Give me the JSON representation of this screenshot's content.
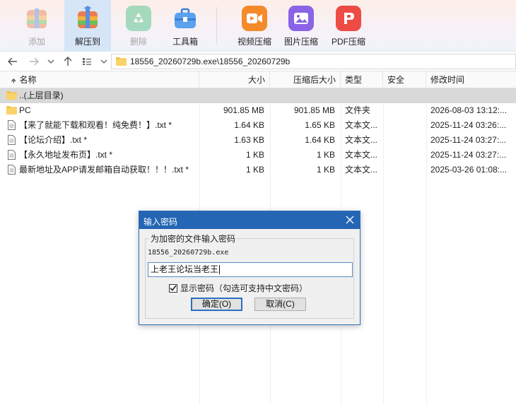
{
  "toolbar": {
    "items": [
      {
        "label": "添加",
        "icon": "add-archive-icon",
        "disabled": true
      },
      {
        "label": "解压到",
        "icon": "extract-icon",
        "active": true
      },
      {
        "label": "删除",
        "icon": "recycle-delete-icon",
        "disabled": true
      },
      {
        "label": "工具箱",
        "icon": "toolbox-icon"
      },
      {
        "label": "视频压缩",
        "icon": "video-compress-icon"
      },
      {
        "label": "图片压缩",
        "icon": "image-compress-icon"
      },
      {
        "label": "PDF压缩",
        "icon": "pdf-compress-icon"
      }
    ]
  },
  "address": {
    "path": "18556_20260729b.exe\\18556_20260729b"
  },
  "columns": {
    "name": "名称",
    "size": "大小",
    "packed": "压缩后大小",
    "type": "类型",
    "security": "安全",
    "modified": "修改时间"
  },
  "rows": [
    {
      "name": "..(上层目录)",
      "size": "",
      "packed": "",
      "type": "",
      "modified": "",
      "icon": "folder-icon"
    },
    {
      "name": "PC",
      "size": "901.85 MB",
      "packed": "901.85 MB",
      "type": "文件夹",
      "modified": "2026-08-03 13:12:...",
      "icon": "folder-icon"
    },
    {
      "name": "【来了就能下载和观看！纯免费！】.txt *",
      "size": "1.64 KB",
      "packed": "1.65 KB",
      "type": "文本文...",
      "modified": "2025-11-24 03:26:...",
      "icon": "text-file-icon"
    },
    {
      "name": "【论坛介绍】.txt *",
      "size": "1.63 KB",
      "packed": "1.64 KB",
      "type": "文本文...",
      "modified": "2025-11-24 03:27:...",
      "icon": "text-file-icon"
    },
    {
      "name": "【永久地址发布页】.txt *",
      "size": "1 KB",
      "packed": "1 KB",
      "type": "文本文...",
      "modified": "2025-11-24 03:27:...",
      "icon": "text-file-icon"
    },
    {
      "name": "最新地址及APP请发邮箱自动获取！！！.txt *",
      "size": "1 KB",
      "packed": "1 KB",
      "type": "文本文...",
      "modified": "2025-03-26 01:08:...",
      "icon": "text-file-icon"
    }
  ],
  "dialog": {
    "title": "输入密码",
    "group_label": "为加密的文件输入密码",
    "file_name": "18556_20260729b.exe",
    "password_value": "上老王论坛当老王",
    "show_password_label": "显示密码（勾选可支持中文密码）",
    "show_password_checked": true,
    "ok_label": "确定(O)",
    "cancel_label": "取消(C)"
  },
  "colors": {
    "accent": "#2465b4",
    "selected_row": "#d9d9d9",
    "active_tool": "#d6e6f7"
  }
}
